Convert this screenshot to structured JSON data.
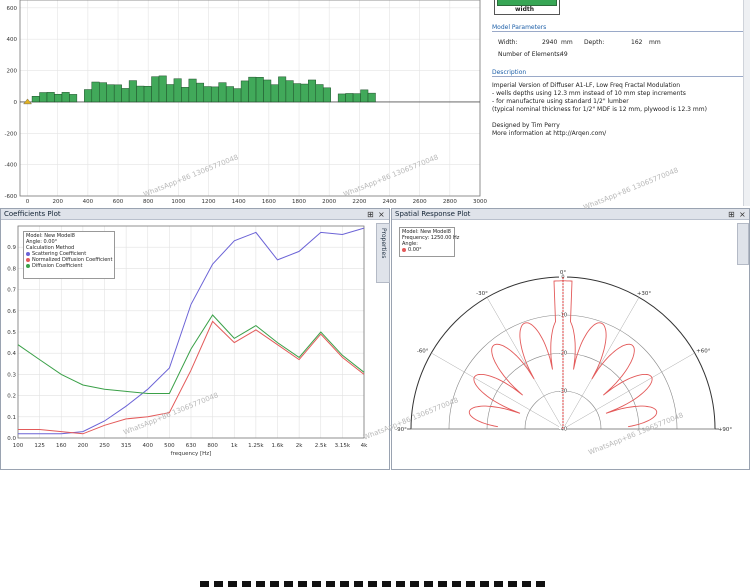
{
  "top_plot": {
    "chart_data": {
      "type": "bar",
      "x_ticks": [
        "0",
        "200",
        "400",
        "600",
        "800",
        "1000",
        "1200",
        "1400",
        "1600",
        "1800",
        "2000",
        "2200",
        "2400",
        "2600",
        "2800",
        "3000"
      ],
      "y_ticks": [
        "600",
        "400",
        "200",
        "0",
        "-200",
        "-400",
        "-600"
      ],
      "xlim": [
        -50,
        3000
      ],
      "ylim": [
        -600,
        650
      ],
      "well_width": 49.5,
      "well_depths": [
        36,
        60,
        61,
        49,
        61,
        48,
        0,
        79,
        127,
        123,
        110,
        109,
        86,
        136,
        101,
        100,
        161,
        166,
        111,
        148,
        93,
        146,
        120,
        98,
        96,
        123,
        98,
        85,
        134,
        158,
        157,
        140,
        110,
        160,
        136,
        117,
        114,
        140,
        111,
        90,
        0,
        51,
        54,
        53,
        77,
        56,
        0
      ]
    }
  },
  "top_right_panel": {
    "width_label": "width",
    "model_parameters_title": "Model Parameters",
    "width_field_label": "Width:",
    "width_value": "2940",
    "width_unit": "mm",
    "depth_field_label": "Depth:",
    "depth_value": "162",
    "depth_unit": "mm",
    "elements_label": "Number of Elements:",
    "elements_value": "49",
    "description_title": "Description",
    "description_lines": [
      "Imperial Version of Diffuser A1-LF, Low Freq Fractal Modulation",
      "- wells depths using 12.3 mm instead of 10 mm step increments",
      "- for manufacture using standard 1/2\" lumber",
      "(typical nominal thickness for 1/2\" MDF is 12 mm, plywood is 12.3 mm)",
      "",
      "Designed by Tim Perry",
      "More information at http://Arqen.com/"
    ]
  },
  "coefficients_panel": {
    "title": "Coefficients Plot",
    "pin_icon": "⊞",
    "close_icon": "×",
    "properties_tab": "Properties",
    "legend": {
      "model_label": "Model:",
      "model_value": "New Model8",
      "angle_label": "Angle:",
      "angle_value": "0.00°",
      "method_label": "Calculation Method",
      "series_names": [
        "Scattering Coefficient",
        "Normalized Diffusion Coefficient",
        "Diffusion Coefficient"
      ],
      "colors": [
        "#6b63d6",
        "#e35a5a",
        "#3aa048"
      ]
    },
    "chart_data": {
      "type": "line",
      "xlabel": "frequency [Hz]",
      "categories": [
        "100",
        "125",
        "160",
        "200",
        "250",
        "315",
        "400",
        "500",
        "630",
        "800",
        "1k",
        "1.25k",
        "1.6k",
        "2k",
        "2.5k",
        "3.15k",
        "4k"
      ],
      "y_ticks": [
        "0.9",
        "0.8",
        "0.7",
        "0.6",
        "0.5",
        "0.4",
        "0.3",
        "0.2",
        "0.1",
        "0.0"
      ],
      "ylim": [
        0,
        1.0
      ],
      "series": [
        {
          "name": "Scattering Coefficient",
          "color": "#6b63d6",
          "values": [
            0.02,
            0.02,
            0.02,
            0.03,
            0.08,
            0.15,
            0.23,
            0.33,
            0.63,
            0.82,
            0.93,
            0.97,
            0.84,
            0.88,
            0.97,
            0.96,
            0.99
          ]
        },
        {
          "name": "Normalized Diffusion Coefficient",
          "color": "#e35a5a",
          "values": [
            0.04,
            0.04,
            0.03,
            0.02,
            0.06,
            0.09,
            0.1,
            0.12,
            0.32,
            0.55,
            0.45,
            0.51,
            0.44,
            0.37,
            0.49,
            0.38,
            0.3
          ]
        },
        {
          "name": "Diffusion Coefficient",
          "color": "#3aa048",
          "values": [
            0.44,
            0.37,
            0.3,
            0.25,
            0.23,
            0.22,
            0.21,
            0.21,
            0.42,
            0.58,
            0.47,
            0.53,
            0.45,
            0.38,
            0.5,
            0.39,
            0.31
          ]
        }
      ]
    }
  },
  "spatial_panel": {
    "title": "Spatial Response Plot",
    "pin_icon": "⊞",
    "close_icon": "×",
    "legend": {
      "model_label": "Model:",
      "model_value": "New Model8",
      "freq_label": "Frequency:",
      "freq_value": "1250.00 Hz",
      "angle_label": "Angle:",
      "angle_value": "0.00°",
      "color": "#e35a5a"
    },
    "chart_data": {
      "type": "polar",
      "angle_labels": [
        "-90°",
        "-60°",
        "-30°",
        "0°",
        "+30°",
        "+60°",
        "+90°"
      ],
      "ring_labels": [
        "0",
        "-10",
        "-20",
        "-30",
        "-40"
      ],
      "rlim": [
        -40,
        0
      ],
      "series": [
        {
          "name": "0.00°",
          "color": "#e35a5a"
        }
      ]
    }
  },
  "watermark": "WhatsApp+86 13065770048"
}
